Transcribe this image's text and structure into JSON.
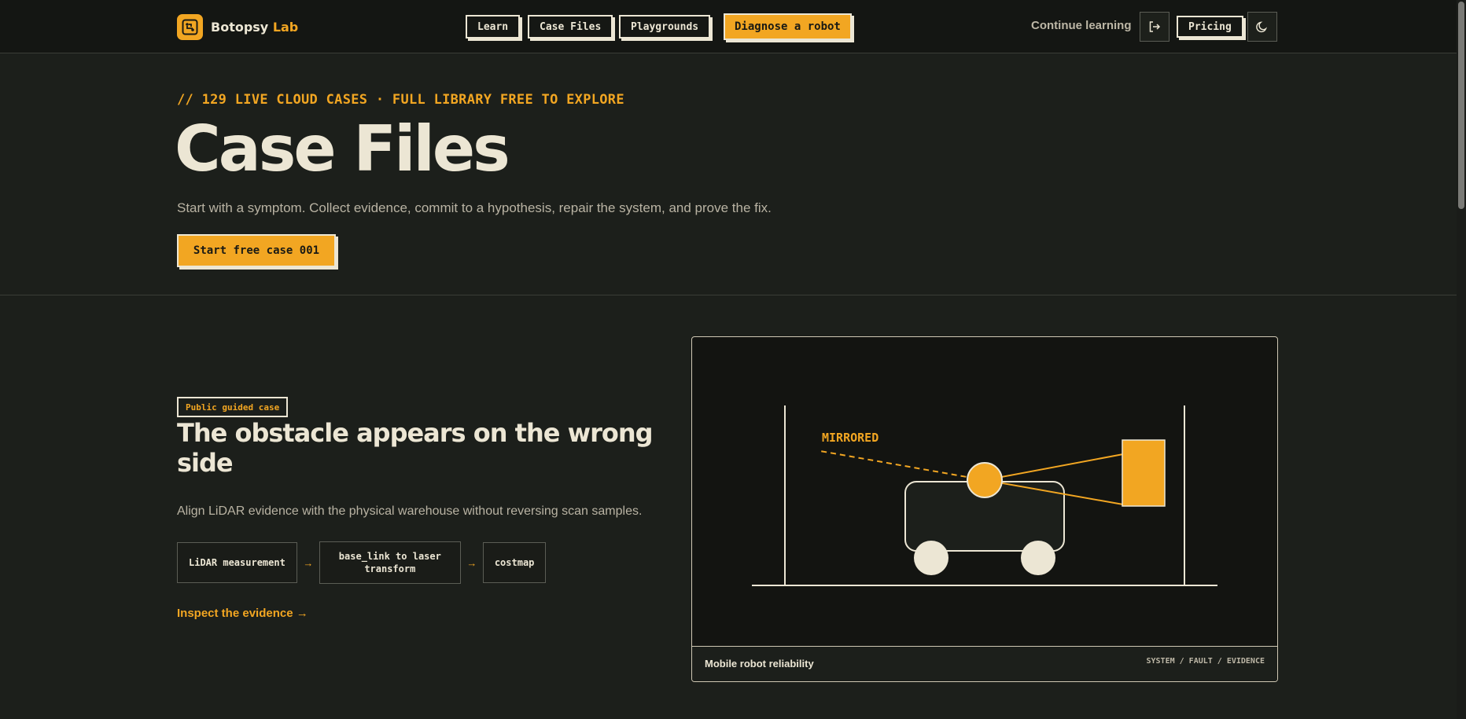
{
  "nav": {
    "brand_name": "Botopsy",
    "brand_accent": "Lab",
    "learn": "Learn",
    "case_files": "Case Files",
    "playgrounds": "Playgrounds",
    "diagnose": "Diagnose a robot",
    "continue": "Continue learning",
    "pricing": "Pricing",
    "login_icon": "login-icon",
    "theme_icon": "moon-icon"
  },
  "hero": {
    "kicker": "// 129 LIVE CLOUD CASES · FULL LIBRARY FREE TO EXPLORE",
    "title": "Case Files",
    "subtitle": "Start with a symptom. Collect evidence, commit to a hypothesis, repair the system, and prove the fix.",
    "cta": "Start free case 001"
  },
  "case": {
    "badge": "Public guided case",
    "title": "The obstacle appears on the wrong side",
    "description": "Align LiDAR evidence with the physical warehouse without reversing scan samples.",
    "chain": [
      "LiDAR measurement",
      "base_link to laser transform",
      "costmap"
    ],
    "inspect": "Inspect the evidence",
    "diagram_label": "MIRRORED",
    "footer_title": "Mobile robot reliability",
    "footer_meta": "SYSTEM / FAULT / EVIDENCE"
  },
  "colors": {
    "accent": "#f2a622",
    "background": "#1c1f1b",
    "nav_background": "#141613",
    "text": "#ece6d4"
  }
}
